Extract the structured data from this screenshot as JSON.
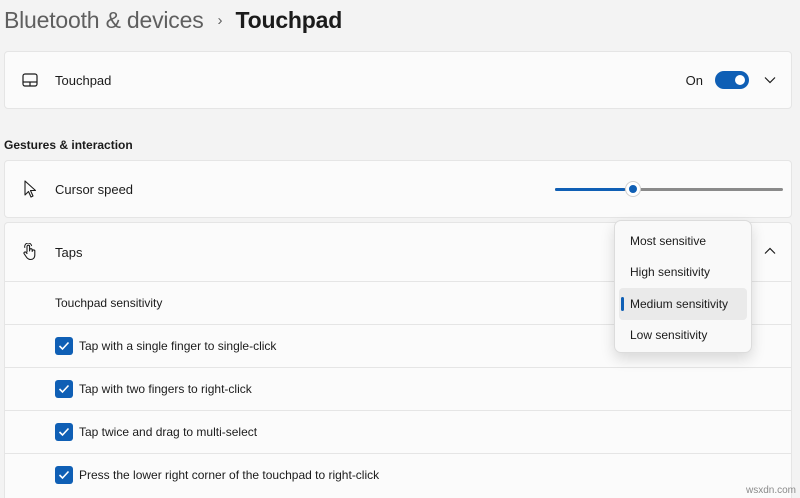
{
  "breadcrumb": {
    "parent": "Bluetooth & devices",
    "separator": "›",
    "current": "Touchpad"
  },
  "touchpad_card": {
    "icon": "touchpad-icon",
    "label": "Touchpad",
    "toggle_state_label": "On",
    "toggle_on": true
  },
  "section": {
    "title": "Gestures & interaction"
  },
  "cursor_speed": {
    "icon": "cursor-arrow-icon",
    "label": "Cursor speed",
    "value_fraction": 0.34
  },
  "taps": {
    "icon": "tap-hand-icon",
    "label": "Taps",
    "sensitivity_label": "Touchpad sensitivity",
    "checkboxes": [
      {
        "label": "Tap with a single finger to single-click",
        "checked": true
      },
      {
        "label": "Tap with two fingers to right-click",
        "checked": true
      },
      {
        "label": "Tap twice and drag to multi-select",
        "checked": true
      },
      {
        "label": "Press the lower right corner of the touchpad to right-click",
        "checked": true
      }
    ]
  },
  "sensitivity_flyout": {
    "options": [
      "Most sensitive",
      "High sensitivity",
      "Medium sensitivity",
      "Low sensitivity"
    ],
    "selected_index": 2
  },
  "watermark": "wsxdn.com",
  "colors": {
    "accent": "#0f5fb5",
    "background": "#f3f3f3",
    "card": "#fbfbfb"
  }
}
